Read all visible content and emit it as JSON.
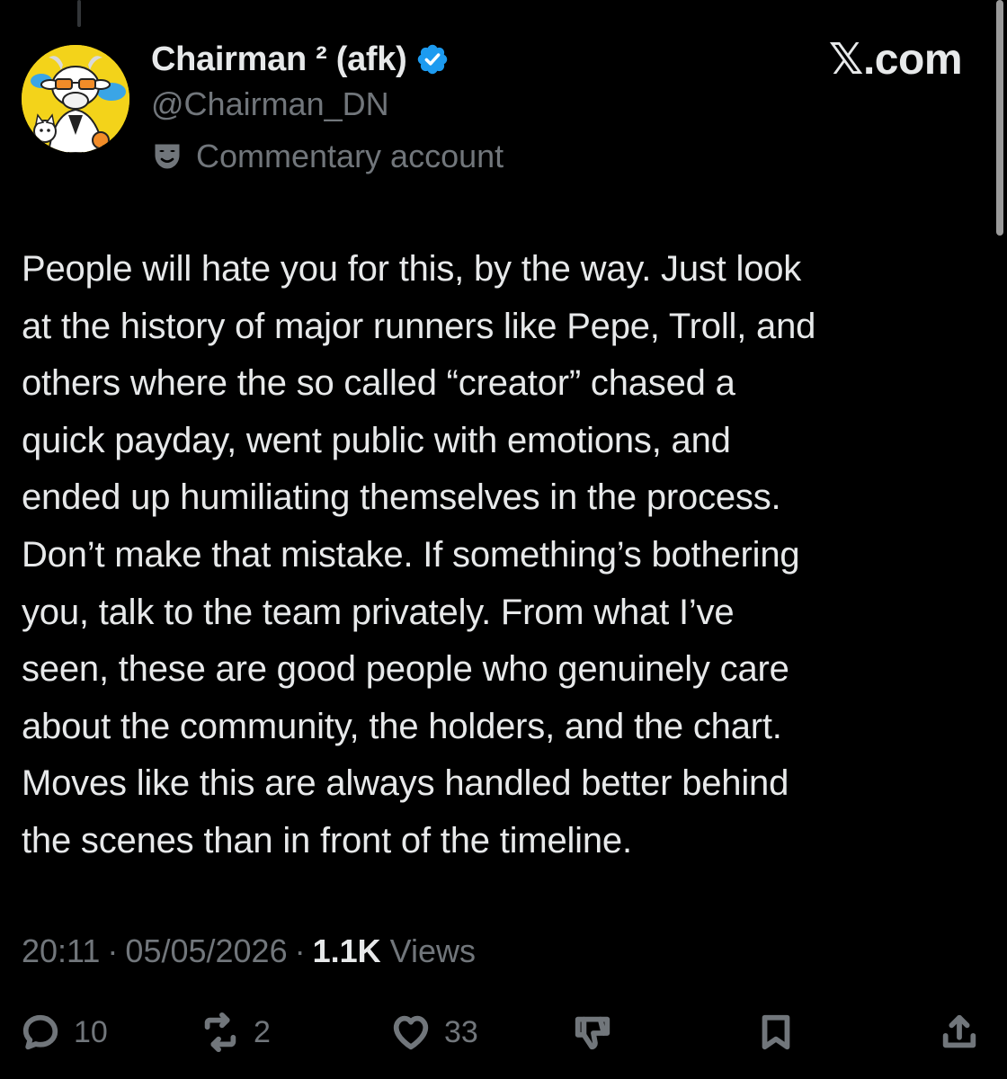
{
  "post": {
    "author": {
      "display_name": "Chairman ² (afk)",
      "handle": "@Chairman_DN",
      "verified": true,
      "account_label": "Commentary account",
      "avatar_icon": "cartoon-goat-avatar",
      "label_icon": "theater-mask-icon"
    },
    "brand": "𝕏.com",
    "text_lines": [
      "People will hate you for this, by the way. Just look",
      "at the history of major runners like Pepe, Troll, and",
      "others where the so called “creator” chased a",
      "quick payday, went public with emotions, and",
      "ended up humiliating themselves in the process.",
      "Don’t make that mistake. If something’s bothering",
      "you, talk to the team privately. From what I’ve",
      "seen, these are good people who genuinely care",
      "about the community, the holders, and the chart.",
      "Moves like this are always handled better behind",
      "the scenes than in front of the timeline."
    ],
    "meta": {
      "time": "20:11",
      "separator": "·",
      "date": "05/05/2026",
      "views_count": "1.1K",
      "views_label": "Views"
    },
    "actions": {
      "reply": {
        "icon": "reply-icon",
        "count": "10"
      },
      "repost": {
        "icon": "repost-icon",
        "count": "2"
      },
      "like": {
        "icon": "heart-icon",
        "count": "33"
      },
      "dislike": {
        "icon": "thumbs-down-icon"
      },
      "bookmark": {
        "icon": "bookmark-icon"
      },
      "share": {
        "icon": "share-icon"
      }
    }
  },
  "colors": {
    "background": "#000000",
    "text_primary": "#e7e9ea",
    "text_secondary": "#71767b",
    "verified_blue": "#1d9bf0",
    "avatar_bg": "#f3d31a"
  }
}
